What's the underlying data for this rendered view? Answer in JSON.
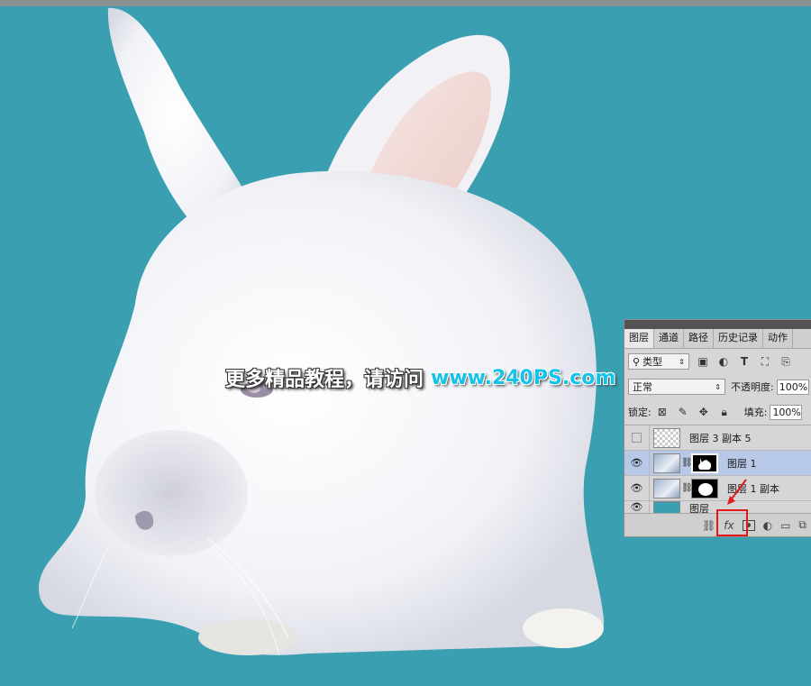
{
  "watermark": {
    "chinese": "更多精品教程，请访问",
    "url": "www.240PS.com"
  },
  "layers_panel": {
    "tabs": [
      "图层",
      "通道",
      "路径",
      "历史记录",
      "动作"
    ],
    "active_tab": "图层",
    "filter_kind": "类型",
    "filter_icons": [
      "image-filter-icon",
      "adjustment-filter-icon",
      "type-filter-icon",
      "shape-filter-icon",
      "smartobject-filter-icon"
    ],
    "blend_mode": "正常",
    "opacity_label": "不透明度:",
    "opacity_value": "100%",
    "lock_label": "锁定:",
    "fill_label": "填充:",
    "fill_value": "100%",
    "layers": [
      {
        "name": "图层 3 副本 5",
        "visible": false,
        "selected": false
      },
      {
        "name": "图层 1",
        "visible": true,
        "selected": true
      },
      {
        "name": "图层 1 副本",
        "visible": true,
        "selected": false
      },
      {
        "name": "图层",
        "visible": true,
        "selected": false
      }
    ],
    "bottom_icons": [
      "link-icon",
      "fx-icon",
      "add-mask-icon",
      "adjustment-icon",
      "group-icon",
      "new-layer-icon"
    ],
    "fx_label": "fx"
  },
  "colors": {
    "canvas_background": "#3a9fb0",
    "highlight": "#e21a1a",
    "selected_layer": "#b7c9e6"
  }
}
